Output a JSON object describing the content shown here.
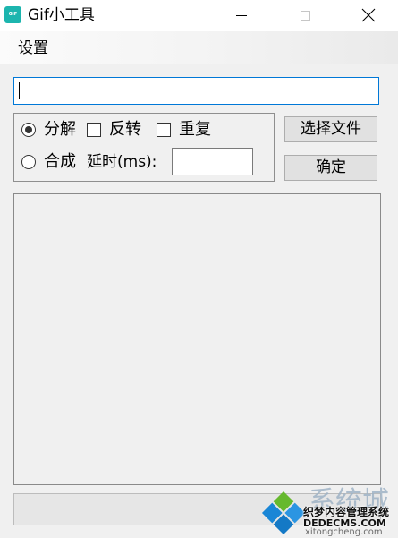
{
  "window": {
    "title": "Gif小工具",
    "icon_text": "GIF"
  },
  "icons": {
    "app": "gif-app-icon",
    "minimize": "minimize-icon",
    "maximize": "maximize-icon",
    "close": "close-icon",
    "caret": "text-caret"
  },
  "colors": {
    "app_icon": "#1cb5ae",
    "focus_border": "#0078d7",
    "window_bg": "#f0f0f0",
    "button_bg": "#e1e1e1",
    "watermark_brand": "#9fb3c6",
    "logo_top": "#66b92e",
    "logo_left": "#1a86d6",
    "logo_right": "#2b95e2",
    "logo_bottom": "#1479c6"
  },
  "menu": {
    "items": [
      {
        "label": "设置"
      }
    ]
  },
  "path_input": {
    "value": ""
  },
  "mode_group": {
    "split": {
      "label": "分解",
      "checked": true
    },
    "reverse": {
      "label": "反转",
      "checked": false
    },
    "repeat": {
      "label": "重复",
      "checked": false
    },
    "compose": {
      "label": "合成",
      "checked": false
    },
    "delay": {
      "label": "延时(ms):",
      "value": ""
    }
  },
  "buttons": {
    "choose_file": "选择文件",
    "confirm": "确定"
  },
  "output_list": {
    "items": []
  },
  "progress": {
    "percent": 0
  },
  "watermark": {
    "brand": "系统城",
    "line1": "织梦内容管理系统",
    "line2": "DEDECMS.COM",
    "line3": "xitongcheng.com"
  }
}
